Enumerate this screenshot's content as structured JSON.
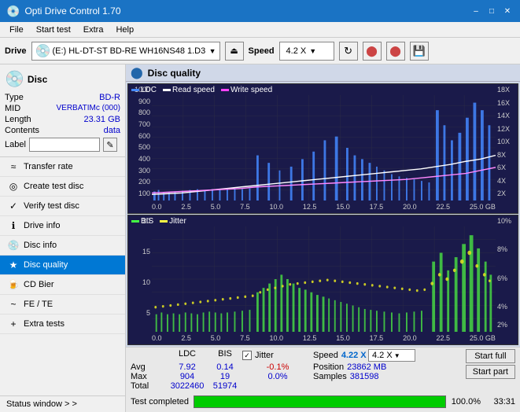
{
  "titlebar": {
    "title": "Opti Drive Control 1.70",
    "minimize": "–",
    "maximize": "□",
    "close": "✕"
  },
  "menubar": {
    "items": [
      "File",
      "Start test",
      "Extra",
      "Help"
    ]
  },
  "drivebar": {
    "label": "Drive",
    "drive_text": "(E:)  HL-DT-ST BD-RE  WH16NS48 1.D3",
    "speed_label": "Speed",
    "speed_value": "4.2 X"
  },
  "disc": {
    "title": "Disc",
    "fields": [
      {
        "key": "Type",
        "val": "BD-R"
      },
      {
        "key": "MID",
        "val": "VERBATIMc (000)"
      },
      {
        "key": "Length",
        "val": "23.31 GB"
      },
      {
        "key": "Contents",
        "val": "data"
      }
    ],
    "label_placeholder": ""
  },
  "nav": {
    "items": [
      {
        "id": "transfer-rate",
        "label": "Transfer rate",
        "icon": "≈"
      },
      {
        "id": "create-test-disc",
        "label": "Create test disc",
        "icon": "◎"
      },
      {
        "id": "verify-test-disc",
        "label": "Verify test disc",
        "icon": "✓"
      },
      {
        "id": "drive-info",
        "label": "Drive info",
        "icon": "ℹ"
      },
      {
        "id": "disc-info",
        "label": "Disc info",
        "icon": "💿"
      },
      {
        "id": "disc-quality",
        "label": "Disc quality",
        "icon": "★",
        "active": true
      },
      {
        "id": "cd-bier",
        "label": "CD Bier",
        "icon": "🍺"
      },
      {
        "id": "fe-te",
        "label": "FE / TE",
        "icon": "~"
      },
      {
        "id": "extra-tests",
        "label": "Extra tests",
        "icon": "+"
      }
    ],
    "status_window": "Status window > >"
  },
  "disc_quality": {
    "title": "Disc quality",
    "chart1": {
      "legend": [
        {
          "label": "LDC",
          "color": "#4488ff"
        },
        {
          "label": "Read speed",
          "color": "#ffffff"
        },
        {
          "label": "Write speed",
          "color": "#ff44ff"
        }
      ],
      "y_left": [
        "1000",
        "900",
        "800",
        "700",
        "600",
        "500",
        "400",
        "300",
        "200",
        "100"
      ],
      "y_right": [
        "18X",
        "16X",
        "14X",
        "12X",
        "10X",
        "8X",
        "6X",
        "4X",
        "2X"
      ],
      "x_labels": [
        "0.0",
        "2.5",
        "5.0",
        "7.5",
        "10.0",
        "12.5",
        "15.0",
        "17.5",
        "20.0",
        "22.5",
        "25.0 GB"
      ]
    },
    "chart2": {
      "legend": [
        {
          "label": "BIS",
          "color": "#44ff44"
        },
        {
          "label": "Jitter",
          "color": "#ffff44"
        }
      ],
      "y_left": [
        "20",
        "15",
        "10",
        "5"
      ],
      "y_right": [
        "10%",
        "8%",
        "6%",
        "4%",
        "2%"
      ],
      "x_labels": [
        "0.0",
        "2.5",
        "5.0",
        "7.5",
        "10.0",
        "12.5",
        "15.0",
        "17.5",
        "20.0",
        "22.5",
        "25.0 GB"
      ]
    }
  },
  "stats": {
    "headers": [
      "",
      "LDC",
      "BIS",
      "",
      "Jitter",
      "Speed",
      ""
    ],
    "avg": {
      "ldc": "7.92",
      "bis": "0.14",
      "jitter": "-0.1%"
    },
    "max": {
      "ldc": "904",
      "bis": "19",
      "jitter": "0.0%"
    },
    "total": {
      "ldc": "3022460",
      "bis": "51974"
    },
    "speed_val": "4.22 X",
    "speed_dropdown": "4.2 X",
    "position": "23862 MB",
    "samples": "381598",
    "jitter_checked": true,
    "jitter_label": "Jitter",
    "speed_label": "Speed",
    "position_label": "Position",
    "samples_label": "Samples",
    "start_full_label": "Start full",
    "start_part_label": "Start part"
  },
  "progressbar": {
    "label": "Test completed",
    "percent": 100,
    "percent_text": "100.0%",
    "time": "33:31"
  }
}
